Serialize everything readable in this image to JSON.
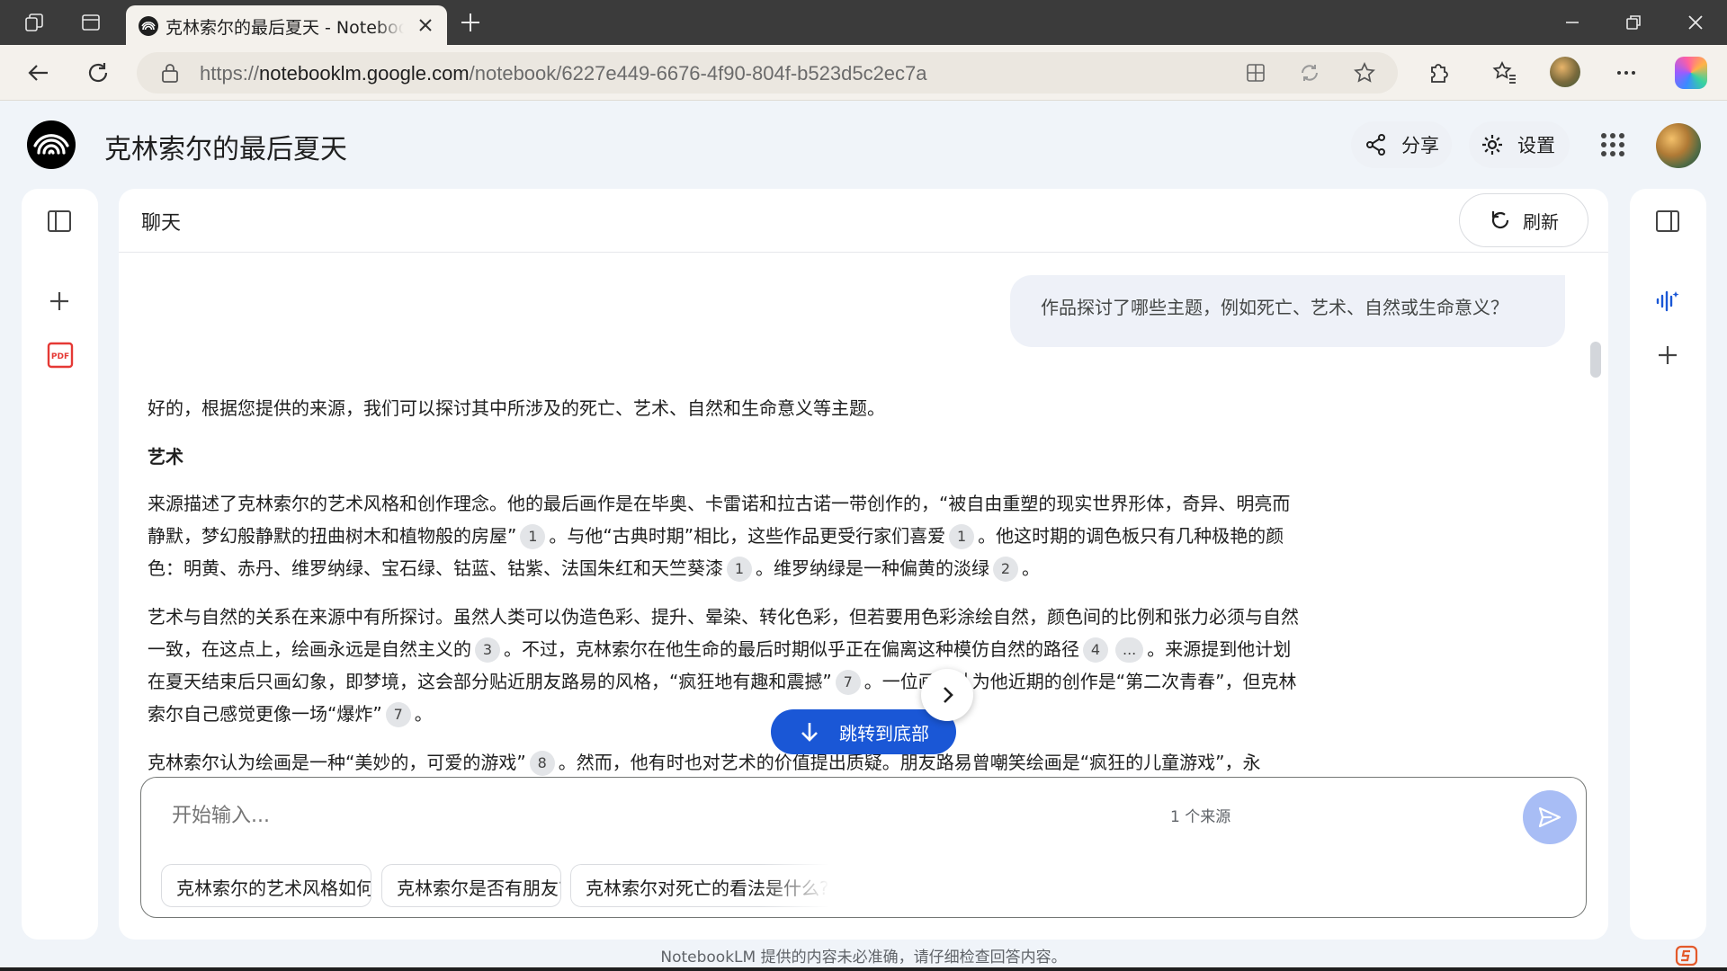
{
  "browser": {
    "tab_title": "克林索尔的最后夏天 - NotebookLM",
    "url_prefix": "https://",
    "url_domain": "notebooklm.google.com",
    "url_path": "/notebook/6227e449-6676-4f90-804f-b523d5c2ec7a"
  },
  "header": {
    "title": "克林索尔的最后夏天",
    "share_label": "分享",
    "settings_label": "设置"
  },
  "chat": {
    "title": "聊天",
    "refresh_label": "刷新",
    "user_question": "作品探讨了哪些主题，例如死亡、艺术、自然或生命意义？",
    "answer": {
      "intro": "好的，根据您提供的来源，我们可以探讨其中所涉及的死亡、艺术、自然和生命意义等主题。",
      "heading": "艺术",
      "p1": [
        "来源描述了克林索尔的艺术风格和创作理念。他的最后画作是在毕奥、卡雷诺和拉古诺一带创作的，“被自由重塑的现实世界形体，奇异、明亮而静默，梦幻般静默的扭曲树木和植物般的房屋”",
        "。与他“古典时期”相比，这些作品更受行家们喜爱",
        "。他这时期的调色板只有几种极艳的颜色：明黄、赤丹、维罗纳绿、宝石绿、钴蓝、钴紫、法国朱红和天竺葵漆",
        "。维罗纳绿是一种偏黄的淡绿",
        "。"
      ],
      "p1_cites": [
        "1",
        "1",
        "1",
        "2"
      ],
      "p2": [
        "艺术与自然的关系在来源中有所探讨。虽然人类可以伪造色彩、提升、晕染、转化色彩，但若要用色彩涂绘自然，颜色间的比例和张力必须与自然一致，在这点上，绘画永远是自然主义的",
        "。不过，克林索尔在他生命的最后时期似乎正在偏离这种模仿自然的路径",
        "。来源提到他计划在夏天结束后只画幻象，即梦境，这会部分贴近朋友路易的风格，“疯狂地有趣和震撼”",
        "。一位画商认为他近期的创作是“第二次青春”，但克林索尔自己感觉更像一场“爆炸”",
        "。"
      ],
      "p2_cites": [
        "3",
        "4",
        "...",
        "7",
        "7"
      ],
      "p3": [
        "克林索尔认为绘画是一种“美妙的，可爱的游戏”",
        "。然而，他有时也对艺术的价值提出质疑。朋友路易曾嘲笑绘画是“疯狂的儿童游戏”，永"
      ],
      "p3_cites": [
        "8"
      ]
    },
    "jump_label": "跳转到底部",
    "input_placeholder": "开始输入...",
    "source_count": "1 个来源",
    "suggestions": [
      "克林索尔的艺术风格如何?",
      "克林索尔是否有朋友?",
      "克林索尔对死亡的看法是什么?"
    ]
  },
  "disclaimer": "NotebookLM 提供的内容未必准确，请仔细检查回答内容。",
  "colors": {
    "accent": "#1a57d6",
    "send_button": "#a8bdf5",
    "pdf_icon": "#e53935"
  }
}
